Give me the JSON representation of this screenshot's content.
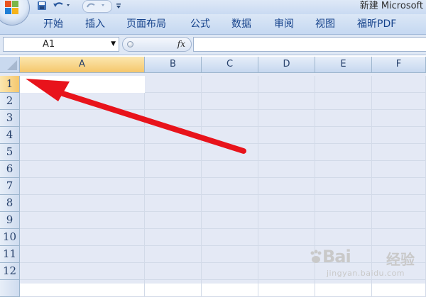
{
  "window": {
    "title": "新建 Microsoft"
  },
  "quick_access": {
    "save_icon": "save-icon",
    "undo_icon": "undo-icon",
    "redo_icon": "redo-icon",
    "more_icon": "dropdown-icon"
  },
  "ribbon": {
    "tabs": [
      "开始",
      "插入",
      "页面布局",
      "公式",
      "数据",
      "审阅",
      "视图",
      "福昕PDF"
    ]
  },
  "formula_bar": {
    "name_box": "A1",
    "fx_label": "fx",
    "formula": ""
  },
  "sheet": {
    "columns": [
      "A",
      "B",
      "C",
      "D",
      "E",
      "F"
    ],
    "rows": [
      "1",
      "2",
      "3",
      "4",
      "5",
      "6",
      "7",
      "8",
      "9",
      "10",
      "11",
      "12"
    ],
    "active_cell": "A1"
  },
  "annotation": {
    "arrow_color": "#e8131b",
    "points_to": "A1"
  },
  "watermark": {
    "brand": "Bai",
    "brand_suffix": "经验",
    "url": "jingyan.baidu.com"
  }
}
